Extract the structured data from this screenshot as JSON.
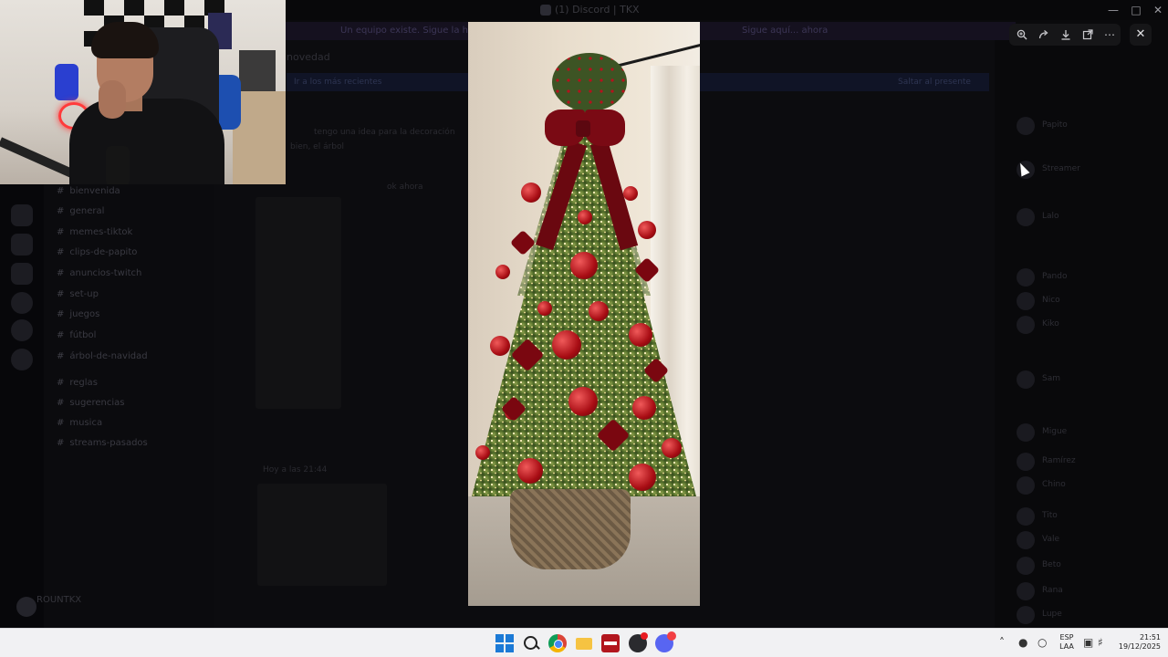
{
  "window": {
    "title": "(1) Discord | TKX"
  },
  "banner": {
    "text_left": "Un equipo existe. Sigue la historia...",
    "text_right": "Sigue aquí... ahora"
  },
  "chat": {
    "header": "novedad",
    "pinned": "Ir a los más recientes",
    "pinned_right": "Saltar al presente",
    "lines": [
      "tengo una idea para la decoración",
      "bien, el árbol",
      "ok ahora",
      "Hoy a las 21:44"
    ]
  },
  "channels": [
    {
      "icon": "#",
      "name": "bienvenida"
    },
    {
      "icon": "#",
      "name": "general"
    },
    {
      "icon": "#",
      "name": "memes-tiktok"
    },
    {
      "icon": "#",
      "name": "clips-de-papito"
    },
    {
      "icon": "#",
      "name": "anuncios-twitch"
    },
    {
      "icon": "#",
      "name": "set-up"
    },
    {
      "icon": "#",
      "name": "juegos"
    },
    {
      "icon": "#",
      "name": "fútbol"
    },
    {
      "icon": "#",
      "name": "árbol-de-navidad"
    },
    {
      "icon": "#",
      "name": "reglas"
    },
    {
      "icon": "#",
      "name": "sugerencias"
    },
    {
      "icon": "#",
      "name": "musica"
    },
    {
      "icon": "#",
      "name": "streams-pasados"
    }
  ],
  "user_panel": {
    "name": "ROUNTKX"
  },
  "members": [
    "Papito",
    "Streamer",
    "Lalo",
    "Pando",
    "Nico",
    "Kiko",
    "Sam",
    "Migue",
    "Ramírez",
    "Chino",
    "Tito",
    "Vale",
    "Beto",
    "Rana",
    "Lupe"
  ],
  "viewer": {
    "toolbar_icons": [
      "zoom-in-icon",
      "forward-icon",
      "download-icon",
      "open-external-icon",
      "more-icon"
    ],
    "close_icon": "close-icon",
    "image_subject": "christmas-tree"
  },
  "taskbar": {
    "apps": [
      "start-icon",
      "search-icon",
      "chrome-icon",
      "file-explorer-icon",
      "news-app-icon",
      "obs-icon",
      "discord-icon"
    ],
    "tray": {
      "lang_top": "ESP",
      "lang_bottom": "LAA",
      "time": "21:51",
      "date": "19/12/2025"
    }
  },
  "colors": {
    "accent": "#5865f2",
    "ornament": "#a80d14",
    "taskbar_bg": "#f1f1f3"
  }
}
